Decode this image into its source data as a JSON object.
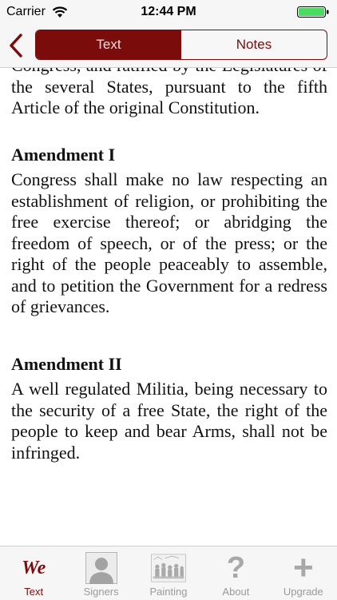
{
  "status": {
    "carrier": "Carrier",
    "time": "12:44 PM"
  },
  "nav": {
    "segments": [
      {
        "label": "Text",
        "selected": true
      },
      {
        "label": "Notes",
        "selected": false
      }
    ]
  },
  "content": {
    "intro": "Congress, and ratified by the Legislatures of the several States, pursuant to the fifth Article of the original Constitution.",
    "amendments": [
      {
        "heading": "Amendment I",
        "text": "Congress shall make no law respecting an establishment of religion, or prohibiting the free exercise thereof; or abridging the freedom of speech, or of the press; or the right of the people peaceably to assemble, and to petition the Government for a redress of grievances."
      },
      {
        "heading": "Amendment II",
        "text": "A well regulated Militia, being necessary to the security of a free State, the right of the people to keep and bear Arms, shall not be infringed."
      }
    ]
  },
  "tabbar": {
    "items": [
      {
        "label": "Text",
        "icon": "we-logo-icon",
        "glyph": "We",
        "active": true
      },
      {
        "label": "Signers",
        "icon": "person-silhouette-icon",
        "active": false
      },
      {
        "label": "Painting",
        "icon": "painting-icon",
        "active": false
      },
      {
        "label": "About",
        "icon": "question-mark-icon",
        "glyph": "?",
        "active": false
      },
      {
        "label": "Upgrade",
        "icon": "plus-icon",
        "glyph": "+",
        "active": false
      }
    ]
  },
  "colors": {
    "accent": "#7a0c0c",
    "bar_bg": "#f6f6f6",
    "inactive": "#9a9a9a",
    "battery": "#4cd964"
  }
}
